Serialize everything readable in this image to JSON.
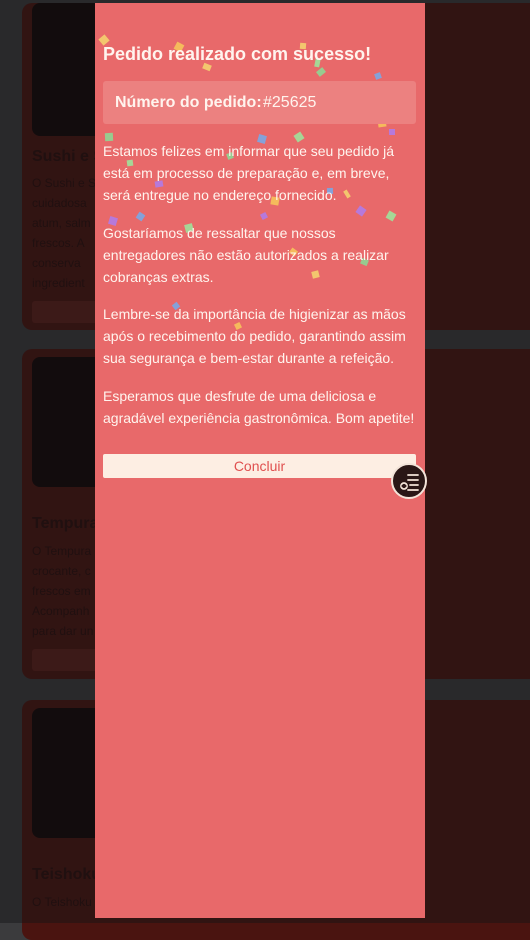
{
  "background_menu": {
    "items": [
      {
        "name": "Sushi e S",
        "description_lines": [
          "O Sushi e S",
          "cuidadosa",
          "atum, salm",
          "frescos. A",
          "conserva",
          "ingredient"
        ]
      },
      {
        "name": "Tempura",
        "description_lines": [
          "O Tempura",
          "crocante, c",
          "frescos em",
          "Acompanh",
          "para dar un"
        ]
      },
      {
        "name": "Teishoku",
        "description_lines": [
          "O Teishoku"
        ]
      }
    ]
  },
  "modal": {
    "title": "Pedido realizado com sucesso!",
    "order_label": "Número do pedido:",
    "order_number": "#25625",
    "paragraphs": [
      "Estamos felizes em informar que seu pedido já está em processo de preparação e, em breve, será entregue no endereço fornecido.",
      "Gostaríamos de ressaltar que nossos entregadores não estão autorizados a realizar cobranças extras.",
      "Lembre-se da importância de higienizar as mãos após o recebimento do pedido, garantindo assim sua segurança e bem-estar durante a refeição.",
      "Esperamos que desfrute de uma deliciosa e agradável experiência gastronômica. Bom apetite!"
    ],
    "confirm_label": "Concluir"
  },
  "fab": {
    "icon": "order-list-icon"
  },
  "colors": {
    "modal_bg": "#e8696a",
    "modal_text": "#fff4ee",
    "order_box_bg": "#ec8180",
    "button_bg": "#fdeee3",
    "button_text": "#e0504f",
    "page_bg": "#3b3b3d"
  }
}
